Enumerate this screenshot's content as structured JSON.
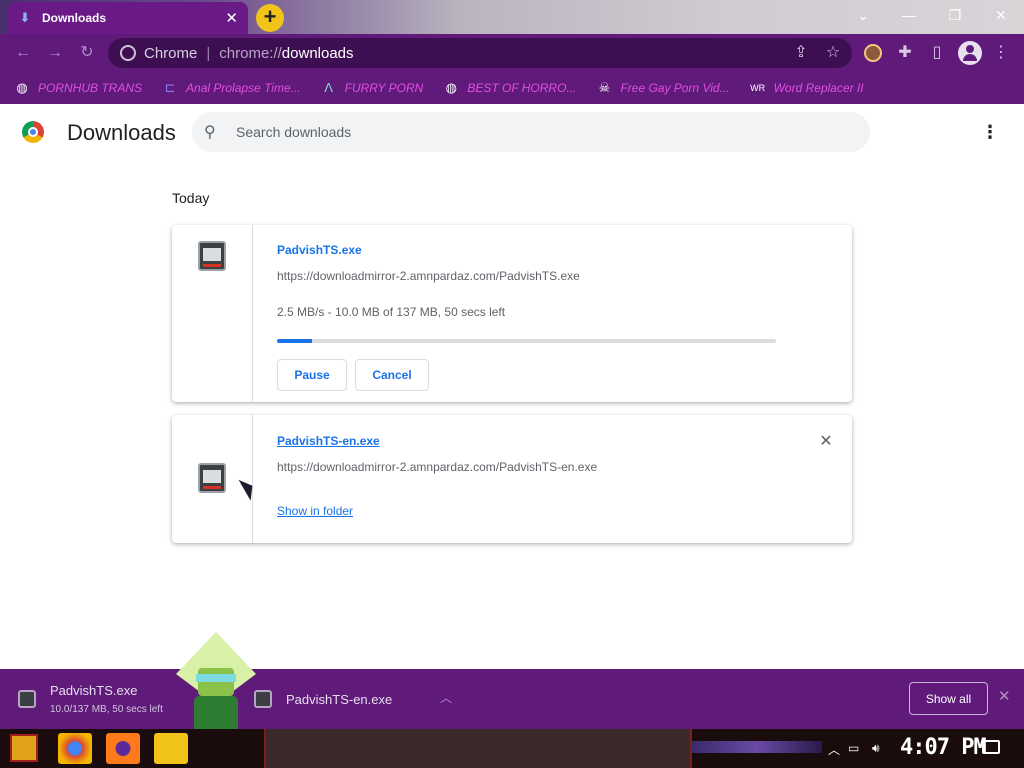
{
  "tab": {
    "title": "Downloads",
    "close_label": "✕"
  },
  "window": {
    "minimize": "—",
    "restore": "❐",
    "close": "✕",
    "tabsearch": "⌄"
  },
  "omnibox": {
    "site_name": "Chrome",
    "scheme": "chrome://",
    "host": "downloads"
  },
  "bookmarks": [
    {
      "label": "PORNHUB TRANS",
      "icon": "globe-icon"
    },
    {
      "label": "Anal Prolapse Time...",
      "icon": "bracket-icon"
    },
    {
      "label": "FURRY PORN",
      "icon": "lambda-icon"
    },
    {
      "label": "BEST OF HORRO...",
      "icon": "globe-icon"
    },
    {
      "label": "Free Gay Porn Vid...",
      "icon": "skull-icon"
    },
    {
      "label": "Word Replacer II",
      "icon": "wr-icon"
    }
  ],
  "page": {
    "title": "Downloads",
    "search_placeholder": "Search downloads",
    "section": "Today"
  },
  "downloads": [
    {
      "name": "PadvishTS.exe",
      "url": "https://downloadmirror-2.amnpardaz.com/PadvishTS.exe",
      "status": "2.5 MB/s - 10.0 MB of 137 MB, 50 secs left",
      "progress_fraction": 0.07,
      "pause_label": "Pause",
      "cancel_label": "Cancel"
    },
    {
      "name": "PadvishTS-en.exe",
      "url": "https://downloadmirror-2.amnpardaz.com/PadvishTS-en.exe",
      "show_in_folder": "Show in folder",
      "remove_label": "✕"
    }
  ],
  "shelf": {
    "items": [
      {
        "name": "PadvishTS.exe",
        "sub": "10.0/137 MB, 50 secs left"
      },
      {
        "name": "PadvishTS-en.exe",
        "sub": ""
      }
    ],
    "show_all": "Show all",
    "close_label": "✕"
  },
  "taskbar": {
    "clock": "4:07 PM"
  },
  "colors": {
    "accent": "#1a73e8",
    "theme": "#5f1a7a"
  }
}
